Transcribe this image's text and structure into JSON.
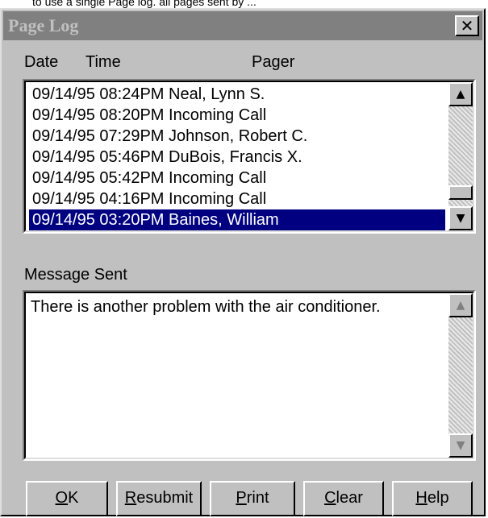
{
  "cropped_caption": "to use a single Page log. all pages sent by ...",
  "window": {
    "title": "Page Log",
    "close_icon": "close-icon"
  },
  "list": {
    "headers": {
      "date": "Date",
      "time": "Time",
      "pager": "Pager"
    },
    "rows": [
      "09/14/95 08:24PM Neal, Lynn S.",
      "09/14/95 08:20PM Incoming Call",
      "09/14/95 07:29PM Johnson, Robert C.",
      "09/14/95 05:46PM DuBois, Francis X.",
      "09/14/95 05:42PM Incoming Call",
      "09/14/95 04:16PM Incoming Call",
      "09/14/95 03:20PM Baines, William"
    ],
    "selected_index": 6
  },
  "message": {
    "label": "Message Sent",
    "text": "There is another problem with the air conditioner."
  },
  "buttons": {
    "ok": {
      "mnemonic": "O",
      "rest": "K"
    },
    "resubmit": {
      "mnemonic": "R",
      "rest": "esubmit"
    },
    "print": {
      "mnemonic": "P",
      "rest": "rint"
    },
    "clear": {
      "mnemonic": "C",
      "rest": "lear"
    },
    "help": {
      "mnemonic": "H",
      "rest": "elp"
    }
  },
  "colors": {
    "selection": "#000080",
    "dialog_face": "#c0c0c0",
    "titlebar_inactive": "#808080"
  }
}
